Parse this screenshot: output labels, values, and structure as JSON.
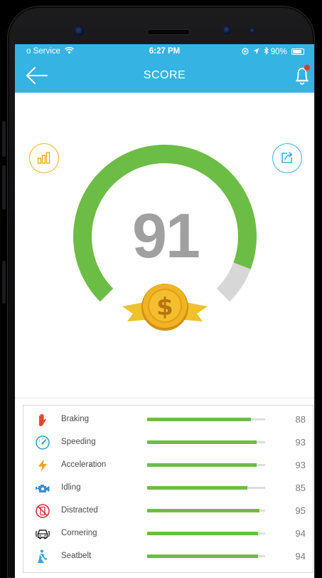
{
  "status_bar": {
    "carrier": "o Service",
    "time": "6:27 PM",
    "battery": "90%"
  },
  "nav": {
    "title": "SCORE",
    "back_icon": "arrow-left-icon",
    "bell_icon": "bell-icon",
    "notification_dot": true
  },
  "score": {
    "value": "91",
    "max": 100,
    "history_icon": "bar-chart-icon",
    "share_icon": "share-icon",
    "badge_icon": "dollar-coin-icon"
  },
  "colors": {
    "header": "#35b4e4",
    "gauge_fill": "#6cbd45",
    "gauge_track": "#d7d7d7",
    "score_text": "#a0a0a0",
    "history_accent": "#f0b21c",
    "share_accent": "#35b4e4",
    "coin": "#e8a717",
    "ribbon": "#f0c020",
    "notification": "#e6393b"
  },
  "metrics": [
    {
      "label": "Braking",
      "value": "88",
      "icon": "hand-stop-icon"
    },
    {
      "label": "Speeding",
      "value": "93",
      "icon": "speedometer-icon"
    },
    {
      "label": "Acceleration",
      "value": "93",
      "icon": "lightning-icon"
    },
    {
      "label": "Idling",
      "value": "85",
      "icon": "engine-icon"
    },
    {
      "label": "Distracted",
      "value": "95",
      "icon": "no-phone-icon"
    },
    {
      "label": "Cornering",
      "value": "94",
      "icon": "car-icon"
    },
    {
      "label": "Seatbelt",
      "value": "94",
      "icon": "seatbelt-icon"
    }
  ]
}
